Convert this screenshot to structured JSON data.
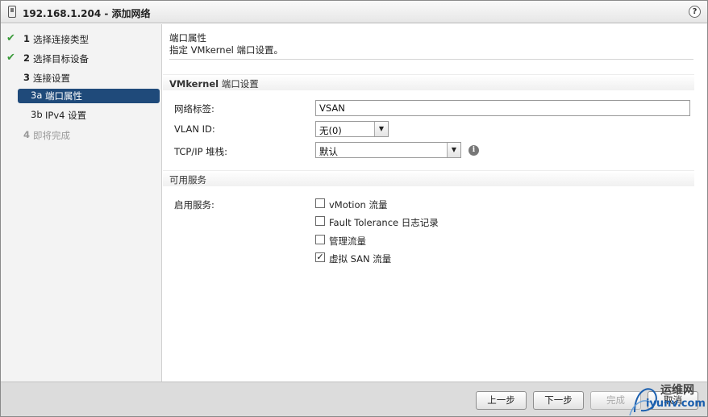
{
  "window": {
    "title": "192.168.1.204 - 添加网络",
    "help_icon": "help-icon",
    "help_glyph": "?"
  },
  "nav": {
    "items": [
      {
        "check": "✔",
        "num": "1",
        "label": "选择连接类型",
        "state": "done"
      },
      {
        "check": "✔",
        "num": "2",
        "label": "选择目标设备",
        "state": "done"
      },
      {
        "check": "",
        "num": "3",
        "label": "连接设置",
        "state": "current"
      },
      {
        "check": "",
        "num": "3a",
        "label": "端口属性",
        "state": "active"
      },
      {
        "check": "",
        "num": "3b",
        "label": "IPv4 设置",
        "state": "pending"
      },
      {
        "check": "",
        "num": "4",
        "label": "即将完成",
        "state": "disabled"
      }
    ]
  },
  "content": {
    "heading": "端口属性",
    "subheading": "指定 VMkernel 端口设置。",
    "port_settings_group": {
      "label_bold": "VMkernel",
      "label_rest": " 端口设置"
    },
    "fields": {
      "network_label": {
        "label": "网络标签:",
        "value": "VSAN"
      },
      "vlan_id": {
        "label": "VLAN ID:",
        "value": "无(0)"
      },
      "tcpip_stack": {
        "label": "TCP/IP 堆栈:",
        "value": "默认"
      }
    },
    "services_group": {
      "label": "可用服务"
    },
    "enable_services_label": "启用服务:",
    "services": [
      {
        "label": "vMotion 流量",
        "checked": false
      },
      {
        "label": "Fault Tolerance 日志记录",
        "checked": false
      },
      {
        "label": "管理流量",
        "checked": false
      },
      {
        "label": "虚拟 SAN 流量",
        "checked": true
      }
    ]
  },
  "footer": {
    "back": "上一步",
    "next": "下一步",
    "finish": "完成",
    "cancel": "取消"
  },
  "watermark": {
    "line1": "运维网",
    "line2": "iyunv.com"
  },
  "colors": {
    "accent": "#1f4a7a",
    "check": "#3a9a3a"
  }
}
